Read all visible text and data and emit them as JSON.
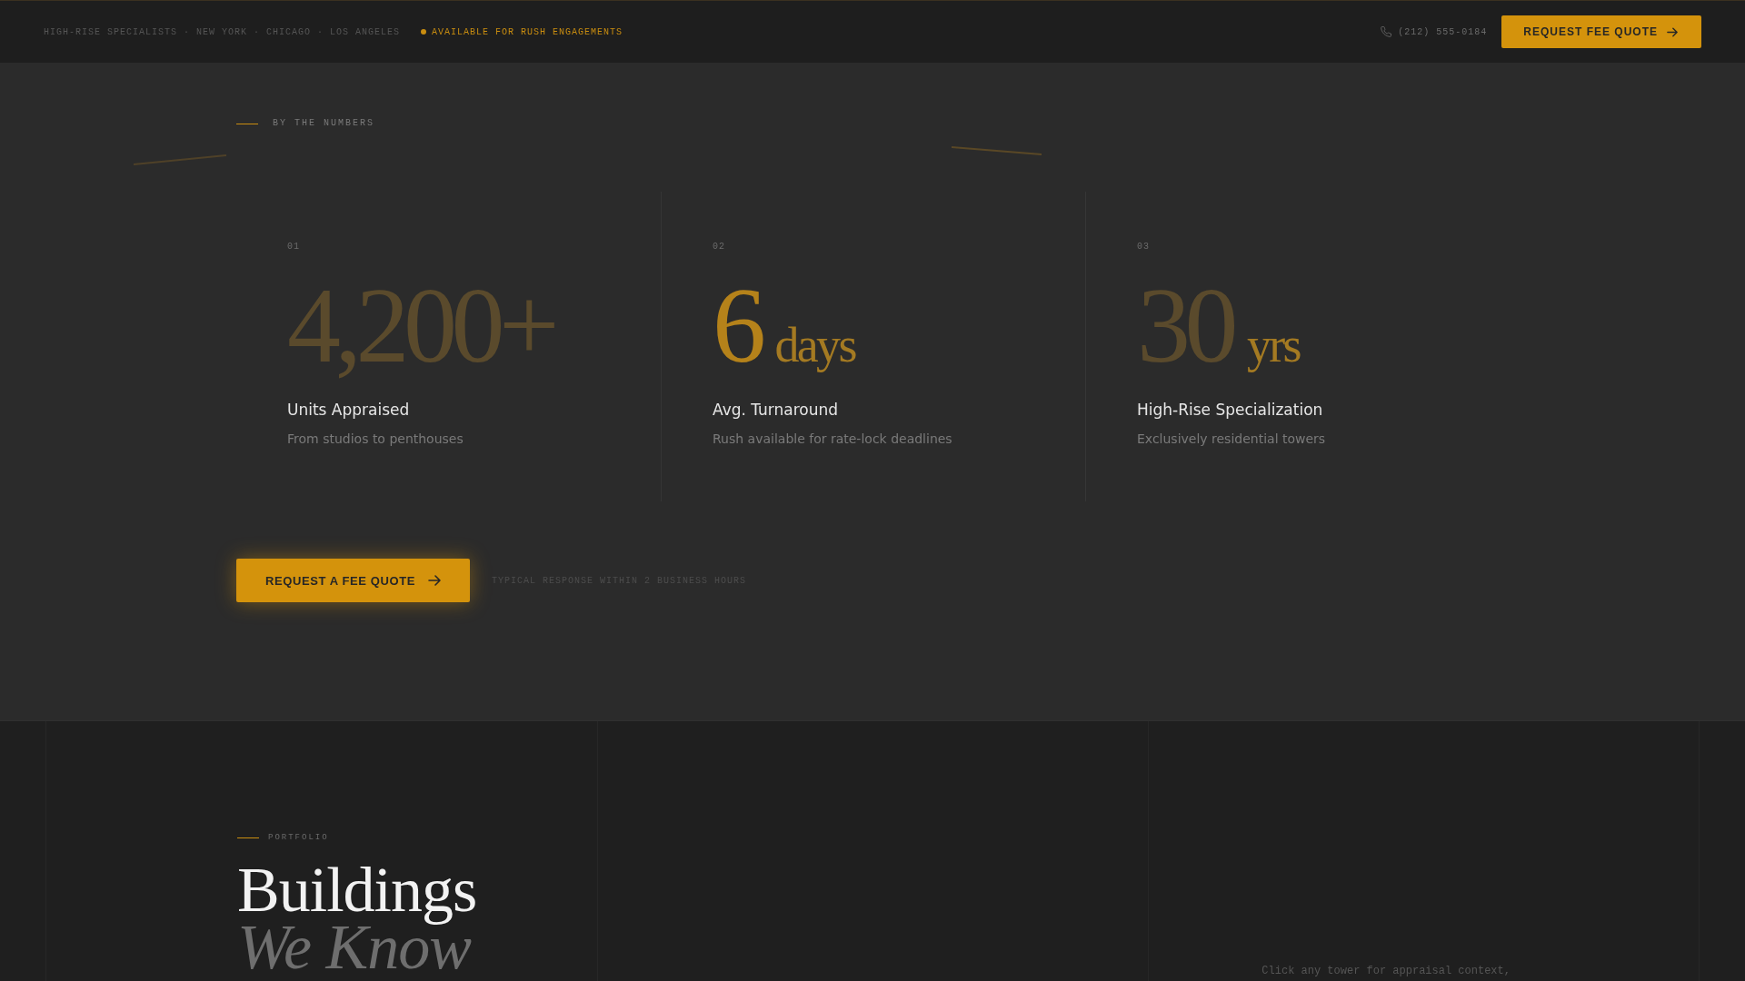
{
  "top_bar": {
    "tagline": "HIGH-RISE SPECIALISTS · NEW YORK · CHICAGO · LOS ANGELES",
    "availability": "AVAILABLE FOR RUSH ENGAGEMENTS",
    "phone": "(212) 555-0184",
    "cta_button": "REQUEST FEE QUOTE"
  },
  "stats_section": {
    "eyebrow": "BY THE NUMBERS",
    "stats": [
      {
        "index": "01",
        "value": "4,200+",
        "label": "Units Appraised",
        "description": "From studios to penthouses",
        "highlighted": false
      },
      {
        "index": "02",
        "value": "6",
        "unit": "days",
        "label": "Avg. Turnaround",
        "description": "Rush available for rate-lock deadlines",
        "highlighted": true
      },
      {
        "index": "03",
        "value": "30",
        "unit": "yrs",
        "label": "High-Rise Specialization",
        "description": "Exclusively residential towers",
        "highlighted": false
      }
    ],
    "cta_button": "REQUEST A FEE QUOTE",
    "response_note": "TYPICAL RESPONSE WITHIN 2 BUSINESS HOURS"
  },
  "portfolio_section": {
    "eyebrow": "PORTFOLIO",
    "title": "Buildings",
    "title_emphasis": "We Know",
    "hint": "Click any tower for appraisal context,"
  }
}
